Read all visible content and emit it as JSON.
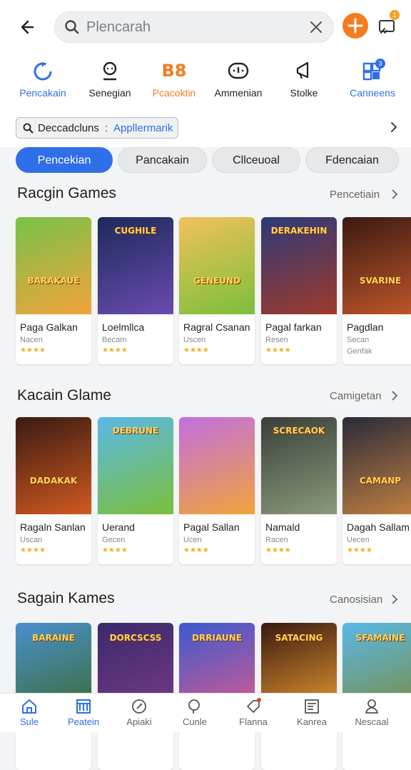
{
  "search": {
    "placeholder": "Plencarah"
  },
  "header": {
    "badge": "1"
  },
  "categories": [
    {
      "label": "Pencakain",
      "icon": "refresh-icon",
      "color": "#2f6fe8",
      "glyph": ""
    },
    {
      "label": "Senegian",
      "icon": "person-icon",
      "color": "#222222",
      "glyph": ""
    },
    {
      "label": "Pcacoktin",
      "icon": "b8-icon",
      "color": "#f47c20",
      "glyph": "B8"
    },
    {
      "label": "Ammenian",
      "icon": "gamepad-icon",
      "color": "#222222",
      "glyph": ""
    },
    {
      "label": "Stolke",
      "icon": "megaphone-icon",
      "color": "#222222",
      "glyph": ""
    },
    {
      "label": "Canneens",
      "icon": "grid-icon",
      "color": "#2f6fe8",
      "glyph": "",
      "badge": "3"
    }
  ],
  "filter": {
    "label": "Deccadcluns",
    "separator": ":",
    "value": "Appllermarik"
  },
  "tabs": [
    "Pencekian",
    "Pancakain",
    "Cllceuoal",
    "Fdencaian"
  ],
  "sections": [
    {
      "title": "Racgin Games",
      "link": "Pencetiain",
      "games": [
        {
          "title": "Paga Galkan",
          "sub": "Nacen",
          "stars": "★★★★",
          "logo": "BARAKAUE",
          "colors": [
            "#78c24a",
            "#f2a33a"
          ]
        },
        {
          "title": "Loelmllca",
          "sub": "Becam",
          "stars": "★★★★",
          "logo": "CUGHILE",
          "colors": [
            "#1c2a5a",
            "#6a4bb0"
          ]
        },
        {
          "title": "Ragral Csanan",
          "sub": "Uscen",
          "stars": "★★★★",
          "logo": "GENEUND",
          "colors": [
            "#f2c15a",
            "#7bbf3a"
          ]
        },
        {
          "title": "Pagal farkan",
          "sub": "Resen",
          "stars": "★★★★",
          "logo": "DERAKEHIN",
          "colors": [
            "#2b3a7a",
            "#a03a2a"
          ]
        },
        {
          "title": "Pagdlan",
          "sub": "Secan",
          "sub2": "Genfak",
          "stars": "",
          "logo": "SVARINE",
          "colors": [
            "#3a1a12",
            "#c0562a"
          ]
        }
      ]
    },
    {
      "title": "Kacain Glame",
      "link": "Camigetan",
      "games": [
        {
          "title": "Ragaln Sanlan",
          "sub": "Uscan",
          "stars": "★★★★",
          "logo": "DADAKAK",
          "colors": [
            "#3a1a12",
            "#d05a20"
          ]
        },
        {
          "title": "Uerand",
          "sub": "Gecen",
          "stars": "★★★★",
          "logo": "DEBRUNE",
          "colors": [
            "#5ab8e8",
            "#7bbf3a"
          ]
        },
        {
          "title": "Pagal Sallan",
          "sub": "Ucen",
          "stars": "★★★★",
          "logo": "",
          "colors": [
            "#c070e0",
            "#f2a33a"
          ]
        },
        {
          "title": "Namald",
          "sub": "Racen",
          "stars": "★★★★",
          "logo": "SCRECAOK",
          "colors": [
            "#3a3f3a",
            "#8a9a7a"
          ]
        },
        {
          "title": "Dagah Sallam",
          "sub": "Uecen",
          "stars": "★★★★",
          "logo": "CAMANP",
          "colors": [
            "#2a2a3a",
            "#c08040"
          ]
        }
      ]
    },
    {
      "title": "Sagain Kames",
      "link": "Canosisian",
      "games": [
        {
          "title": "",
          "sub": "",
          "stars": "",
          "logo": "BARAINE",
          "colors": [
            "#4a90d0",
            "#3a6a2a"
          ]
        },
        {
          "title": "",
          "sub": "",
          "stars": "",
          "logo": "DORCSCSS",
          "colors": [
            "#3a2a6a",
            "#7a3a8a"
          ]
        },
        {
          "title": "",
          "sub": "",
          "stars": "",
          "logo": "DRRIAUNE",
          "colors": [
            "#3a5ad0",
            "#e05a8a"
          ]
        },
        {
          "title": "",
          "sub": "",
          "stars": "",
          "logo": "SATACING",
          "colors": [
            "#3a1a12",
            "#f0a030"
          ]
        },
        {
          "title": "",
          "sub": "",
          "stars": "",
          "logo": "SFAMAINE",
          "colors": [
            "#5ab8e8",
            "#7a8a3a"
          ]
        }
      ]
    }
  ],
  "bottom_nav": [
    {
      "label": "Sule",
      "icon": "home-icon",
      "active": true
    },
    {
      "label": "Peatein",
      "icon": "store-icon",
      "active": true
    },
    {
      "label": "Apiaki",
      "icon": "edit-icon",
      "active": false
    },
    {
      "label": "Cunle",
      "icon": "search-icon",
      "active": false
    },
    {
      "label": "Flanna",
      "icon": "tag-icon",
      "active": false
    },
    {
      "label": "Kanrea",
      "icon": "news-icon",
      "active": false
    },
    {
      "label": "Nescaal",
      "icon": "profile-icon",
      "active": false
    }
  ]
}
